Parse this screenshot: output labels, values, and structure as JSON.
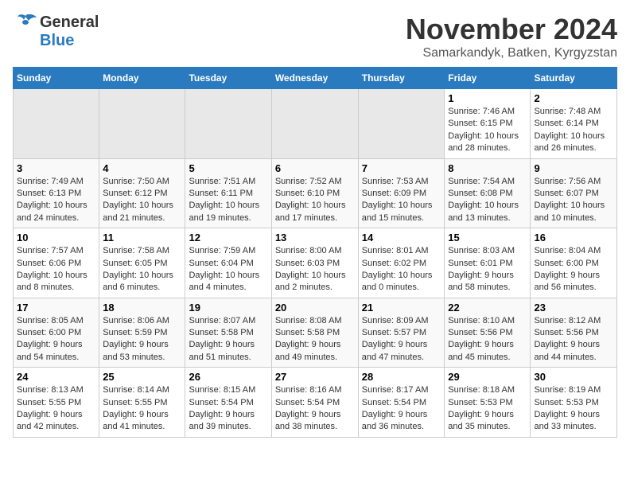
{
  "header": {
    "logo_general": "General",
    "logo_blue": "Blue",
    "month_title": "November 2024",
    "location": "Samarkandyk, Batken, Kyrgyzstan"
  },
  "days_of_week": [
    "Sunday",
    "Monday",
    "Tuesday",
    "Wednesday",
    "Thursday",
    "Friday",
    "Saturday"
  ],
  "weeks": [
    {
      "row_class": "row-odd",
      "days": [
        {
          "num": "",
          "info": "",
          "empty": true
        },
        {
          "num": "",
          "info": "",
          "empty": true
        },
        {
          "num": "",
          "info": "",
          "empty": true
        },
        {
          "num": "",
          "info": "",
          "empty": true
        },
        {
          "num": "",
          "info": "",
          "empty": true
        },
        {
          "num": "1",
          "info": "Sunrise: 7:46 AM\nSunset: 6:15 PM\nDaylight: 10 hours\nand 28 minutes."
        },
        {
          "num": "2",
          "info": "Sunrise: 7:48 AM\nSunset: 6:14 PM\nDaylight: 10 hours\nand 26 minutes."
        }
      ]
    },
    {
      "row_class": "row-even",
      "days": [
        {
          "num": "3",
          "info": "Sunrise: 7:49 AM\nSunset: 6:13 PM\nDaylight: 10 hours\nand 24 minutes."
        },
        {
          "num": "4",
          "info": "Sunrise: 7:50 AM\nSunset: 6:12 PM\nDaylight: 10 hours\nand 21 minutes."
        },
        {
          "num": "5",
          "info": "Sunrise: 7:51 AM\nSunset: 6:11 PM\nDaylight: 10 hours\nand 19 minutes."
        },
        {
          "num": "6",
          "info": "Sunrise: 7:52 AM\nSunset: 6:10 PM\nDaylight: 10 hours\nand 17 minutes."
        },
        {
          "num": "7",
          "info": "Sunrise: 7:53 AM\nSunset: 6:09 PM\nDaylight: 10 hours\nand 15 minutes."
        },
        {
          "num": "8",
          "info": "Sunrise: 7:54 AM\nSunset: 6:08 PM\nDaylight: 10 hours\nand 13 minutes."
        },
        {
          "num": "9",
          "info": "Sunrise: 7:56 AM\nSunset: 6:07 PM\nDaylight: 10 hours\nand 10 minutes."
        }
      ]
    },
    {
      "row_class": "row-odd",
      "days": [
        {
          "num": "10",
          "info": "Sunrise: 7:57 AM\nSunset: 6:06 PM\nDaylight: 10 hours\nand 8 minutes."
        },
        {
          "num": "11",
          "info": "Sunrise: 7:58 AM\nSunset: 6:05 PM\nDaylight: 10 hours\nand 6 minutes."
        },
        {
          "num": "12",
          "info": "Sunrise: 7:59 AM\nSunset: 6:04 PM\nDaylight: 10 hours\nand 4 minutes."
        },
        {
          "num": "13",
          "info": "Sunrise: 8:00 AM\nSunset: 6:03 PM\nDaylight: 10 hours\nand 2 minutes."
        },
        {
          "num": "14",
          "info": "Sunrise: 8:01 AM\nSunset: 6:02 PM\nDaylight: 10 hours\nand 0 minutes."
        },
        {
          "num": "15",
          "info": "Sunrise: 8:03 AM\nSunset: 6:01 PM\nDaylight: 9 hours\nand 58 minutes."
        },
        {
          "num": "16",
          "info": "Sunrise: 8:04 AM\nSunset: 6:00 PM\nDaylight: 9 hours\nand 56 minutes."
        }
      ]
    },
    {
      "row_class": "row-even",
      "days": [
        {
          "num": "17",
          "info": "Sunrise: 8:05 AM\nSunset: 6:00 PM\nDaylight: 9 hours\nand 54 minutes."
        },
        {
          "num": "18",
          "info": "Sunrise: 8:06 AM\nSunset: 5:59 PM\nDaylight: 9 hours\nand 53 minutes."
        },
        {
          "num": "19",
          "info": "Sunrise: 8:07 AM\nSunset: 5:58 PM\nDaylight: 9 hours\nand 51 minutes."
        },
        {
          "num": "20",
          "info": "Sunrise: 8:08 AM\nSunset: 5:58 PM\nDaylight: 9 hours\nand 49 minutes."
        },
        {
          "num": "21",
          "info": "Sunrise: 8:09 AM\nSunset: 5:57 PM\nDaylight: 9 hours\nand 47 minutes."
        },
        {
          "num": "22",
          "info": "Sunrise: 8:10 AM\nSunset: 5:56 PM\nDaylight: 9 hours\nand 45 minutes."
        },
        {
          "num": "23",
          "info": "Sunrise: 8:12 AM\nSunset: 5:56 PM\nDaylight: 9 hours\nand 44 minutes."
        }
      ]
    },
    {
      "row_class": "row-odd",
      "days": [
        {
          "num": "24",
          "info": "Sunrise: 8:13 AM\nSunset: 5:55 PM\nDaylight: 9 hours\nand 42 minutes."
        },
        {
          "num": "25",
          "info": "Sunrise: 8:14 AM\nSunset: 5:55 PM\nDaylight: 9 hours\nand 41 minutes."
        },
        {
          "num": "26",
          "info": "Sunrise: 8:15 AM\nSunset: 5:54 PM\nDaylight: 9 hours\nand 39 minutes."
        },
        {
          "num": "27",
          "info": "Sunrise: 8:16 AM\nSunset: 5:54 PM\nDaylight: 9 hours\nand 38 minutes."
        },
        {
          "num": "28",
          "info": "Sunrise: 8:17 AM\nSunset: 5:54 PM\nDaylight: 9 hours\nand 36 minutes."
        },
        {
          "num": "29",
          "info": "Sunrise: 8:18 AM\nSunset: 5:53 PM\nDaylight: 9 hours\nand 35 minutes."
        },
        {
          "num": "30",
          "info": "Sunrise: 8:19 AM\nSunset: 5:53 PM\nDaylight: 9 hours\nand 33 minutes."
        }
      ]
    }
  ]
}
